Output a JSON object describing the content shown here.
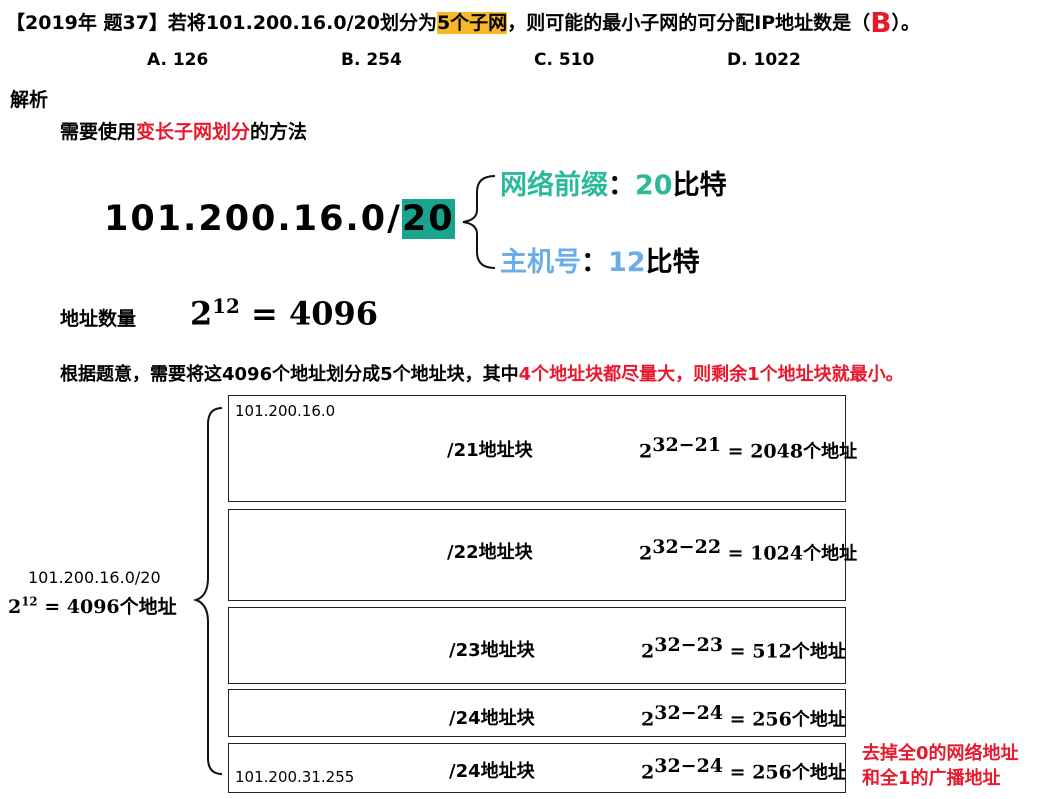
{
  "question": {
    "prefix": "【2019年 题37】若将101.200.16.0/20划分为",
    "highlight": "5个子网",
    "middle": "，则可能的最小子网的可分配IP地址数是（",
    "answer": "B",
    "suffix": "）。",
    "options": [
      "A. 126",
      "B. 254",
      "C. 510",
      "D. 1022"
    ]
  },
  "analysis": {
    "heading": "解析",
    "method_prefix": "需要使用",
    "method_highlight": "变长子网划分",
    "method_suffix": "的方法",
    "ip_base": "101.200.16.0/",
    "ip_prefix_len": "20",
    "net_prefix_label": "网络前缀",
    "net_prefix_colon": "：",
    "net_prefix_bits_num": "20",
    "net_prefix_bits_unit": "比特",
    "host_label": "主机号",
    "host_colon": "：",
    "host_bits_num": "12",
    "host_bits_unit": "比特",
    "addr_count_label": "地址数量",
    "addr_count_base": "2",
    "addr_count_exp": "12",
    "addr_count_rest": " = 4096",
    "desc_black": "根据题意，需要将这4096个地址划分成5个地址块，其中",
    "desc_red": "4个地址块都尽量大，则剩余1个地址块就最小。"
  },
  "left_label": {
    "network": "101.200.16.0/20",
    "base": "2",
    "exp": "12",
    "eq": " = 4096",
    "unit": "个地址"
  },
  "blocks": [
    {
      "start": "101.200.16.0",
      "end": "",
      "label": "/21地址块",
      "exp": "32−21",
      "eq": " = 2048",
      "unit": "个地址"
    },
    {
      "start": "",
      "end": "",
      "label": "/22地址块",
      "exp": "32−22",
      "eq": " = 1024",
      "unit": "个地址"
    },
    {
      "start": "",
      "end": "",
      "label": "/23地址块",
      "exp": "32−23",
      "eq": " = 512",
      "unit": "个地址"
    },
    {
      "start": "",
      "end": "",
      "label": "/24地址块",
      "exp": "32−24",
      "eq": " = 256",
      "unit": "个地址"
    },
    {
      "start": "",
      "end": "101.200.31.255",
      "label": "/24地址块",
      "exp": "32−24",
      "eq": " = 256",
      "unit": "个地址"
    }
  ],
  "note": {
    "line1": "去掉全0的网络地址",
    "line2": "和全1的广播地址"
  },
  "colors": {
    "red": "#e8192c",
    "orange_highlight": "#f7b829",
    "teal_highlight": "#19a48d",
    "green_label": "#2bb99c",
    "blue_label": "#6aaee7"
  }
}
